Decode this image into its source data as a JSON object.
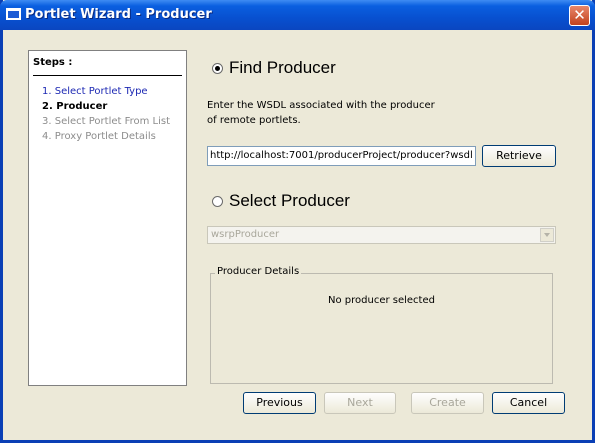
{
  "window": {
    "title": "Portlet Wizard - Producer",
    "close_label": "✕"
  },
  "steps": {
    "title": "Steps :",
    "items": [
      {
        "label": "1. Select Portlet Type",
        "state": "done"
      },
      {
        "label": "2. Producer",
        "state": "current"
      },
      {
        "label": "3. Select Portlet From List",
        "state": "future"
      },
      {
        "label": "4. Proxy Portlet Details",
        "state": "future"
      }
    ]
  },
  "find": {
    "label": "Find Producer",
    "selected": true,
    "description_line1": "Enter the WSDL associated with the producer",
    "description_line2": "of remote portlets.",
    "wsdl_value": "http://localhost:7001/producerProject/producer?wsdl",
    "retrieve_label": "Retrieve"
  },
  "select": {
    "label": "Select Producer",
    "selected": false,
    "dropdown_value": "wsrpProducer",
    "dropdown_enabled": false
  },
  "details": {
    "legend": "Producer Details",
    "message": "No producer selected"
  },
  "buttons": {
    "previous": {
      "label": "Previous",
      "enabled": true
    },
    "next": {
      "label": "Next",
      "enabled": false
    },
    "create": {
      "label": "Create",
      "enabled": false
    },
    "cancel": {
      "label": "Cancel",
      "enabled": true
    }
  }
}
